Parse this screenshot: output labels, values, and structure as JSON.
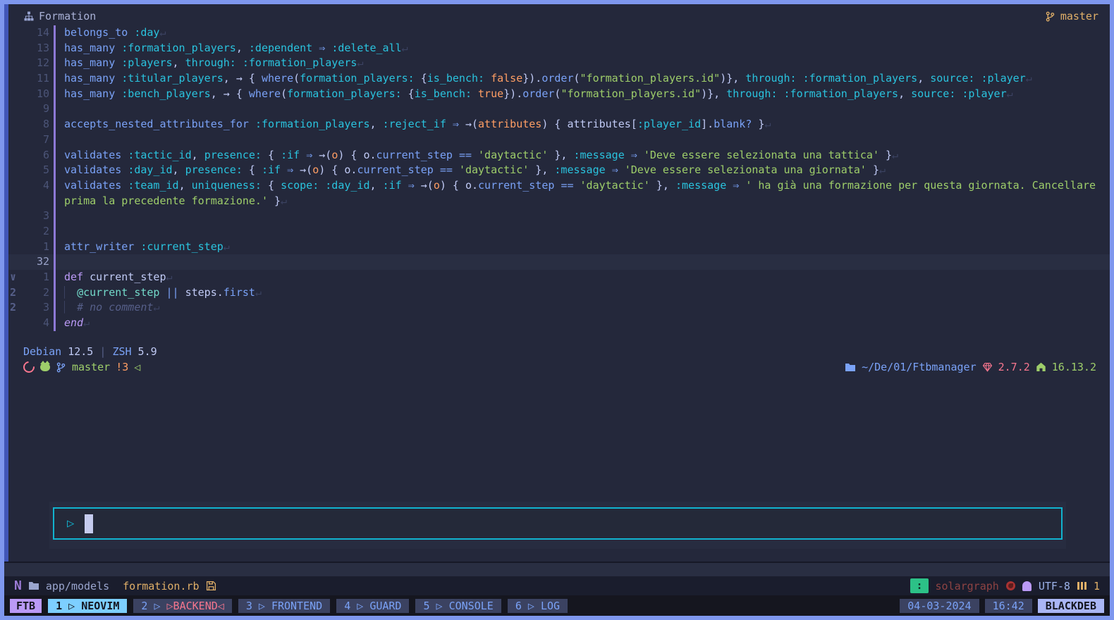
{
  "colors": {
    "frame": "#7e97ee",
    "bg": "#24283b",
    "accent_cyan": "#11b3cf",
    "blue": "#7aa2f7",
    "cyan": "#2ac3de",
    "green": "#9ece6a",
    "orange": "#ff9e64",
    "yellow": "#e0af68",
    "red": "#f7768e",
    "purple": "#bb9af7",
    "mode_badge": "#2cc187",
    "tab_active": "#7dcfff",
    "tab_inactive": "#3b4261"
  },
  "icons": {
    "sitemap-icon": "svg",
    "git-branch-icon": "svg",
    "debian-icon": "css-swirl",
    "github-icon": "css-cat",
    "folder-icon": "svg",
    "gem-icon": "svg",
    "node-icon": "svg",
    "play-icon": "▷",
    "prompt-arrow-icon": "◁",
    "collapse-arrow-icon": "∨",
    "save-icon": "svg",
    "neovim-icon": "N",
    "copilot-ghost-icon": "css",
    "lsp-status-icon": "css-circle",
    "buffers-icon": "css-bars"
  },
  "window": {
    "title": "Formation",
    "branch": "master"
  },
  "editor": {
    "lines": [
      {
        "num": "14",
        "tokens": [
          [
            "k",
            "belongs_to"
          ],
          [
            "c",
            " "
          ],
          [
            "s",
            ":day"
          ],
          [
            "r",
            "↵"
          ]
        ]
      },
      {
        "num": "13",
        "tokens": [
          [
            "k",
            "has_many"
          ],
          [
            "c",
            " "
          ],
          [
            "s",
            ":formation_players"
          ],
          [
            "c",
            ", "
          ],
          [
            "s",
            ":dependent"
          ],
          [
            "c",
            " "
          ],
          [
            "o",
            "⇒"
          ],
          [
            "c",
            " "
          ],
          [
            "s",
            ":delete_all"
          ],
          [
            "r",
            "↵"
          ]
        ]
      },
      {
        "num": "12",
        "tokens": [
          [
            "k",
            "has_many"
          ],
          [
            "c",
            " "
          ],
          [
            "s",
            ":players"
          ],
          [
            "c",
            ", "
          ],
          [
            "s",
            "through:"
          ],
          [
            "c",
            " "
          ],
          [
            "s",
            ":formation_players"
          ],
          [
            "r",
            "↵"
          ]
        ]
      },
      {
        "num": "11",
        "tokens": [
          [
            "k",
            "has_many"
          ],
          [
            "c",
            " "
          ],
          [
            "s",
            ":titular_players"
          ],
          [
            "c",
            ", → { "
          ],
          [
            "k",
            "where"
          ],
          [
            "c",
            "("
          ],
          [
            "s",
            "formation_players:"
          ],
          [
            "c",
            " {"
          ],
          [
            "s",
            "is_bench:"
          ],
          [
            "c",
            " "
          ],
          [
            "b",
            "false"
          ],
          [
            "c",
            "})."
          ],
          [
            "k",
            "order"
          ],
          [
            "c",
            "("
          ],
          [
            "t",
            "\"formation_players.id\""
          ],
          [
            "c",
            ")}, "
          ],
          [
            "s",
            "through:"
          ],
          [
            "c",
            " "
          ],
          [
            "s",
            ":formation_players"
          ],
          [
            "c",
            ", "
          ],
          [
            "s",
            "source:"
          ],
          [
            "c",
            " "
          ],
          [
            "s",
            ":player"
          ],
          [
            "r",
            "↵"
          ]
        ]
      },
      {
        "num": "10",
        "tokens": [
          [
            "k",
            "has_many"
          ],
          [
            "c",
            " "
          ],
          [
            "s",
            ":bench_players"
          ],
          [
            "c",
            ", → { "
          ],
          [
            "k",
            "where"
          ],
          [
            "c",
            "("
          ],
          [
            "s",
            "formation_players:"
          ],
          [
            "c",
            " {"
          ],
          [
            "s",
            "is_bench:"
          ],
          [
            "c",
            " "
          ],
          [
            "b",
            "true"
          ],
          [
            "c",
            "})."
          ],
          [
            "k",
            "order"
          ],
          [
            "c",
            "("
          ],
          [
            "t",
            "\"formation_players.id\""
          ],
          [
            "c",
            ")}, "
          ],
          [
            "s",
            "through:"
          ],
          [
            "c",
            " "
          ],
          [
            "s",
            ":formation_players"
          ],
          [
            "c",
            ", "
          ],
          [
            "s",
            "source:"
          ],
          [
            "c",
            " "
          ],
          [
            "s",
            ":player"
          ],
          [
            "r",
            "↵"
          ]
        ]
      },
      {
        "num": "9",
        "tokens": []
      },
      {
        "num": "8",
        "tokens": [
          [
            "k",
            "accepts_nested_attributes_for"
          ],
          [
            "c",
            " "
          ],
          [
            "s",
            ":formation_players"
          ],
          [
            "c",
            ", "
          ],
          [
            "s",
            ":reject_if"
          ],
          [
            "c",
            " "
          ],
          [
            "o",
            "⇒"
          ],
          [
            "c",
            " →("
          ],
          [
            "b",
            "attributes"
          ],
          [
            "c",
            ") { attributes["
          ],
          [
            "s",
            ":player_id"
          ],
          [
            "c",
            "]."
          ],
          [
            "k",
            "blank?"
          ],
          [
            "c",
            " }"
          ],
          [
            "r",
            "↵"
          ]
        ]
      },
      {
        "num": "7",
        "tokens": []
      },
      {
        "num": "6",
        "tokens": [
          [
            "k",
            "validates"
          ],
          [
            "c",
            " "
          ],
          [
            "s",
            ":tactic_id"
          ],
          [
            "c",
            ", "
          ],
          [
            "s",
            "presence:"
          ],
          [
            "c",
            " { "
          ],
          [
            "s",
            ":if"
          ],
          [
            "c",
            " "
          ],
          [
            "o",
            "⇒"
          ],
          [
            "c",
            " →("
          ],
          [
            "b",
            "o"
          ],
          [
            "c",
            ") { o."
          ],
          [
            "k",
            "current_step"
          ],
          [
            "c",
            " "
          ],
          [
            "o",
            "=="
          ],
          [
            "c",
            " "
          ],
          [
            "t",
            "'daytactic'"
          ],
          [
            "c",
            " }, "
          ],
          [
            "s",
            ":message"
          ],
          [
            "c",
            " "
          ],
          [
            "o",
            "⇒"
          ],
          [
            "c",
            " "
          ],
          [
            "t",
            "'Deve essere selezionata una tattica'"
          ],
          [
            "c",
            " }"
          ],
          [
            "r",
            "↵"
          ]
        ]
      },
      {
        "num": "5",
        "tokens": [
          [
            "k",
            "validates"
          ],
          [
            "c",
            " "
          ],
          [
            "s",
            ":day_id"
          ],
          [
            "c",
            ", "
          ],
          [
            "s",
            "presence:"
          ],
          [
            "c",
            " { "
          ],
          [
            "s",
            ":if"
          ],
          [
            "c",
            " "
          ],
          [
            "o",
            "⇒"
          ],
          [
            "c",
            " →("
          ],
          [
            "b",
            "o"
          ],
          [
            "c",
            ") { o."
          ],
          [
            "k",
            "current_step"
          ],
          [
            "c",
            " "
          ],
          [
            "o",
            "=="
          ],
          [
            "c",
            " "
          ],
          [
            "t",
            "'daytactic'"
          ],
          [
            "c",
            " }, "
          ],
          [
            "s",
            ":message"
          ],
          [
            "c",
            " "
          ],
          [
            "o",
            "⇒"
          ],
          [
            "c",
            " "
          ],
          [
            "t",
            "'Deve essere selezionata una giornata'"
          ],
          [
            "c",
            " }"
          ],
          [
            "r",
            "↵"
          ]
        ]
      },
      {
        "num": "4",
        "tokens": [
          [
            "k",
            "validates"
          ],
          [
            "c",
            " "
          ],
          [
            "s",
            ":team_id"
          ],
          [
            "c",
            ", "
          ],
          [
            "s",
            "uniqueness:"
          ],
          [
            "c",
            " { "
          ],
          [
            "s",
            "scope:"
          ],
          [
            "c",
            " "
          ],
          [
            "s",
            ":day_id"
          ],
          [
            "c",
            ", "
          ],
          [
            "s",
            ":if"
          ],
          [
            "c",
            " "
          ],
          [
            "o",
            "⇒"
          ],
          [
            "c",
            " →("
          ],
          [
            "b",
            "o"
          ],
          [
            "c",
            ") { o."
          ],
          [
            "k",
            "current_step"
          ],
          [
            "c",
            " "
          ],
          [
            "o",
            "=="
          ],
          [
            "c",
            " "
          ],
          [
            "t",
            "'daytactic'"
          ],
          [
            "c",
            " }, "
          ],
          [
            "s",
            ":message"
          ],
          [
            "c",
            " "
          ],
          [
            "o",
            "⇒"
          ],
          [
            "c",
            " "
          ],
          [
            "t",
            "' ha già una formazione per questa giornata. Cancellare"
          ]
        ]
      },
      {
        "num": "",
        "tokens": [
          [
            "t",
            "prima la precedente formazione.'"
          ],
          [
            "c",
            " }"
          ],
          [
            "r",
            "↵"
          ]
        ]
      },
      {
        "num": "3",
        "tokens": []
      },
      {
        "num": "2",
        "tokens": []
      },
      {
        "num": "1",
        "tokens": [
          [
            "k",
            "attr_writer"
          ],
          [
            "c",
            " "
          ],
          [
            "s",
            ":current_step"
          ],
          [
            "r",
            "↵"
          ]
        ]
      },
      {
        "num": "32",
        "current": true,
        "tokens": []
      },
      {
        "num": "1",
        "fold": "∨",
        "tokens": [
          [
            "d",
            "def"
          ],
          [
            "c",
            " current_step"
          ],
          [
            "r",
            "↵"
          ]
        ]
      },
      {
        "num": "2",
        "fold": "2",
        "tokens": [
          [
            "g",
            "▏ "
          ],
          [
            "i",
            "@current_step"
          ],
          [
            "c",
            " "
          ],
          [
            "o",
            "||"
          ],
          [
            "c",
            " steps."
          ],
          [
            "k",
            "first"
          ],
          [
            "r",
            "↵"
          ]
        ]
      },
      {
        "num": "3",
        "fold": "2",
        "tokens": [
          [
            "g",
            "▏ "
          ],
          [
            "m",
            "# no comment"
          ],
          [
            "r",
            "↵"
          ]
        ]
      },
      {
        "num": "4",
        "tokens": [
          [
            "e",
            "end"
          ],
          [
            "r",
            "↵"
          ]
        ]
      }
    ]
  },
  "terminal": {
    "os_line": [
      [
        "k",
        "Debian"
      ],
      [
        "c",
        " 12.5 "
      ],
      [
        "m",
        "|"
      ],
      [
        "c",
        " "
      ],
      [
        "k",
        "ZSH"
      ],
      [
        "c",
        " 5.9"
      ]
    ],
    "prompt": {
      "branch": "master",
      "changes": "!3",
      "arrow": "◁",
      "path": "~/De/01/Ftbmanager",
      "ruby_version": "2.7.2",
      "node_version": "16.13.2"
    }
  },
  "input": {
    "play_symbol": "▷"
  },
  "statusline": {
    "file_dir": "app/models",
    "file_name": "formation.rb",
    "mode_symbol": ":",
    "lsp_name": "solargraph",
    "encoding": "UTF-8",
    "buffer_count": "1"
  },
  "tmux": {
    "session": "FTB",
    "windows": [
      {
        "n": "1",
        "label": "NEOVIM",
        "active": true
      },
      {
        "n": "2",
        "label": "BACKEND",
        "alert": true
      },
      {
        "n": "3",
        "label": "FRONTEND"
      },
      {
        "n": "4",
        "label": "GUARD"
      },
      {
        "n": "5",
        "label": "CONSOLE"
      },
      {
        "n": "6",
        "label": "LOG"
      }
    ],
    "date": "04-03-2024",
    "time": "16:42",
    "hostname": "BLACKDEB"
  }
}
